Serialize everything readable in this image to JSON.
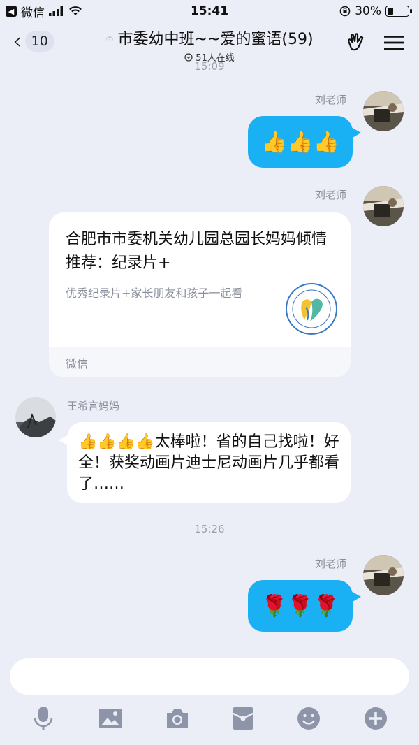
{
  "status_bar": {
    "carrier": "微信",
    "time": "15:41",
    "battery": "30%",
    "battery_level": 0.3
  },
  "nav": {
    "back_count": "10",
    "title": "市委幼中班~~爱的蜜语(59)",
    "online": "51人在线"
  },
  "timestamps": {
    "top": "15:09",
    "middle": "15:26"
  },
  "messages": {
    "m1": {
      "sender": "刘老师",
      "content": "👍👍👍"
    },
    "m2": {
      "sender": "刘老师",
      "card_title": "合肥市市委机关幼儿园总园长妈妈倾情推荐：纪录片+",
      "card_desc": "优秀纪录片+家长朋友和孩子一起看",
      "card_source": "微信"
    },
    "m3": {
      "sender": "王希言妈妈",
      "text": "👍👍👍👍太棒啦！省的自己找啦！好全！获奖动画片迪士尼动画片几乎都看了……"
    },
    "m4": {
      "sender": "刘老师",
      "content": "🌹🌹🌹"
    }
  },
  "colors": {
    "bubble_blue": "#1ab0f4",
    "background": "#ebeef7",
    "toolbar_icon": "#8e95a8"
  },
  "icons": [
    "mic-icon",
    "image-icon",
    "camera-icon",
    "red-packet-icon",
    "emoji-icon",
    "plus-icon"
  ]
}
